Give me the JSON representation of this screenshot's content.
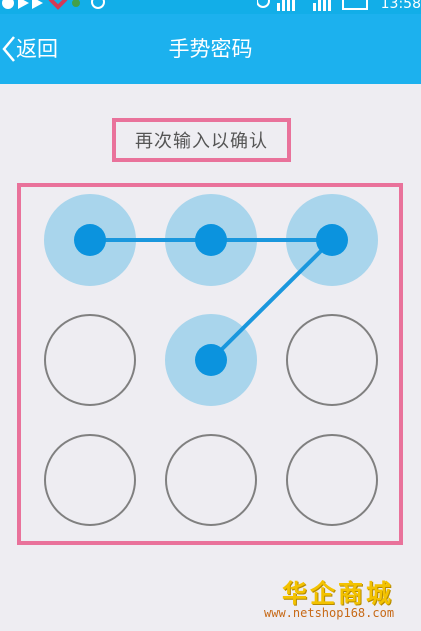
{
  "status_bar": {
    "time": "13:58",
    "background": "#12aee8",
    "icons": [
      "app-notification-icon",
      "play-icon",
      "alarm-clock-icon",
      "signal-icon",
      "wifi-icon",
      "battery-icon"
    ]
  },
  "title_bar": {
    "back_label": "返回",
    "title": "手势密码",
    "background": "#1cb1ee"
  },
  "prompt": {
    "text": "再次输入以确认"
  },
  "pattern": {
    "rows": 3,
    "cols": 3,
    "selected_sequence": [
      1,
      2,
      3,
      5
    ],
    "colors": {
      "selected_fill": "#a9d5ec",
      "dot": "#0b93de",
      "line": "#1a97dd",
      "idle_ring": "#808080"
    }
  },
  "highlight_color": "#e9729b",
  "watermark": {
    "logo_text": "华企商城",
    "url": "www.netshop168.com"
  }
}
